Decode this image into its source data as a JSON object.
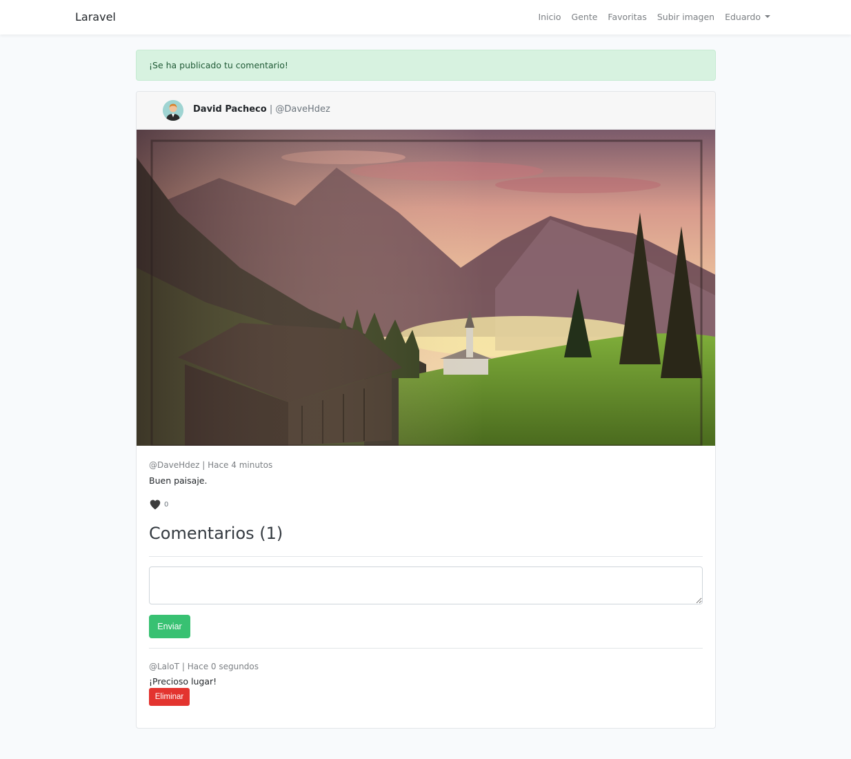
{
  "navbar": {
    "brand": "Laravel",
    "links": [
      "Inicio",
      "Gente",
      "Favoritas",
      "Subir imagen"
    ],
    "user_menu": "Eduardo"
  },
  "alert": {
    "message": "¡Se ha publicado tu comentario!",
    "color": "#d7f2e0"
  },
  "post": {
    "author_name": "David Pacheco",
    "author_separator": " | ",
    "author_handle": "@DaveHdez",
    "image_icon": "landscape-image",
    "meta": "@DaveHdez | Hace 4 minutos",
    "description": "Buen paisaje.",
    "like_icon": "heart-icon",
    "likes": "0"
  },
  "comments": {
    "title": "Comentarios (1)",
    "input_value": "",
    "submit_label": "Enviar",
    "submit_color": "#38c172",
    "items": [
      {
        "meta": "@LaloT | Hace 0 segundos",
        "text": "¡Precioso lugar!",
        "delete_label": "Eliminar",
        "delete_color": "#e3342f"
      }
    ]
  }
}
